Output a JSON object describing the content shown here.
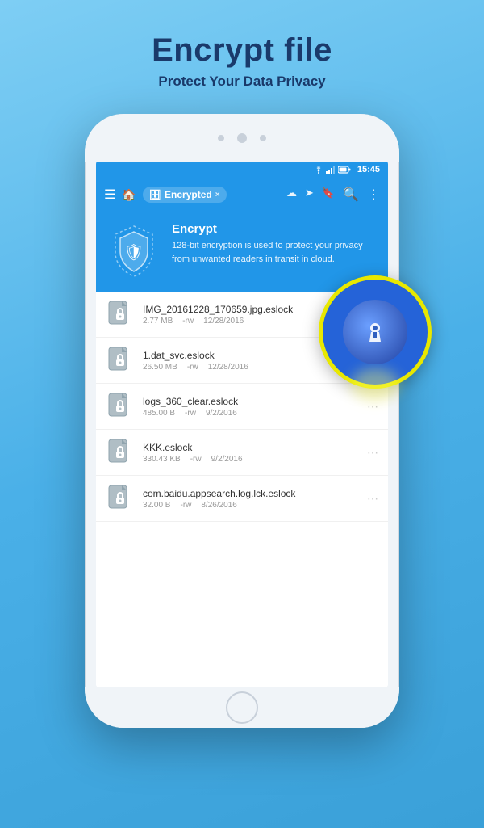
{
  "page": {
    "title": "Encrypt file",
    "subtitle": "Protect Your Data Privacy"
  },
  "status_bar": {
    "time": "15:45",
    "icons": [
      "wifi",
      "signal",
      "battery"
    ]
  },
  "nav": {
    "tab_label": "Encrypted",
    "tab_icon": "database-icon",
    "close_icon": "×"
  },
  "banner": {
    "title": "Encrypt",
    "description": "128-bit encryption is used to protect your privacy from unwanted readers in transit in cloud."
  },
  "files": [
    {
      "name": "IMG_20161228_170659.jpg.eslock",
      "size": "2.77 MB",
      "perm": "-rw",
      "date": "12/28/2016"
    },
    {
      "name": "1.dat_svc.eslock",
      "size": "26.50 MB",
      "perm": "-rw",
      "date": "12/28/2016"
    },
    {
      "name": "logs_360_clear.eslock",
      "size": "485.00 B",
      "perm": "-rw",
      "date": "9/2/2016"
    },
    {
      "name": "KKK.eslock",
      "size": "330.43 KB",
      "perm": "-rw",
      "date": "9/2/2016"
    },
    {
      "name": "com.baidu.appsearch.log.lck.eslock",
      "size": "32.00 B",
      "perm": "-rw",
      "date": "8/26/2016"
    }
  ],
  "colors": {
    "primary": "#2196e8",
    "accent": "#e8e800",
    "background": "#7ecef4"
  }
}
